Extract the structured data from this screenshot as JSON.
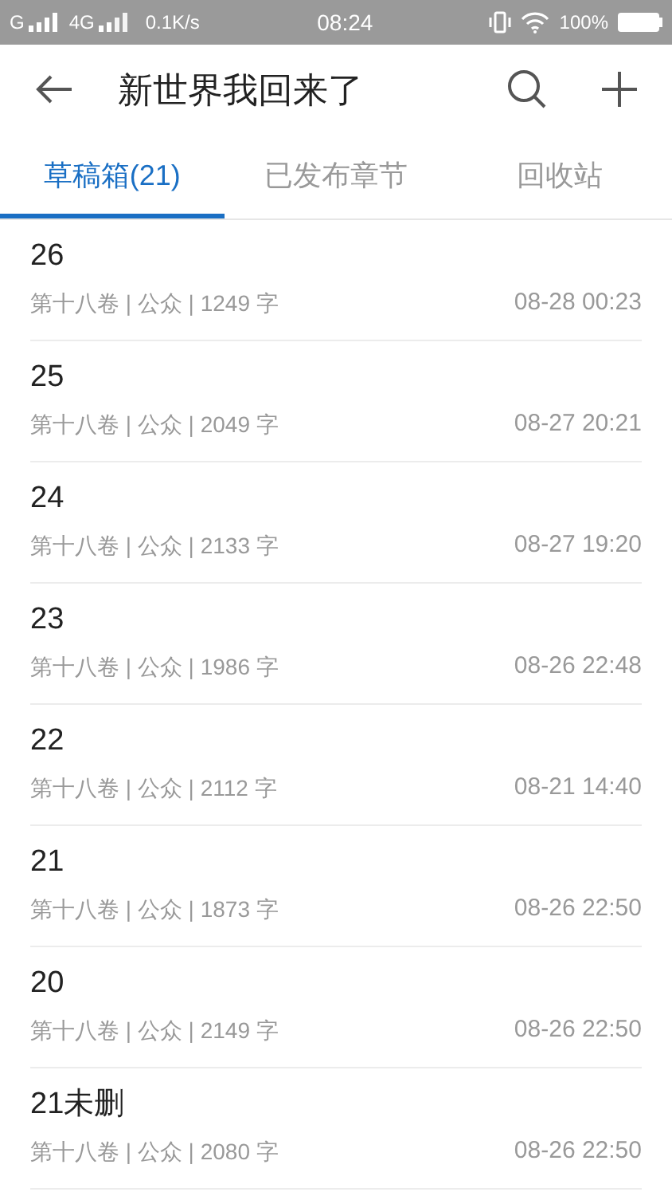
{
  "status_bar": {
    "carrier_1": "G",
    "carrier_2": "4G",
    "speed": "0.1K/s",
    "time": "08:24",
    "battery": "100%"
  },
  "header": {
    "title": "新世界我回来了"
  },
  "tabs": [
    {
      "label": "草稿箱(21)",
      "selected": true
    },
    {
      "label": "已发布章节",
      "selected": false
    },
    {
      "label": "回收站",
      "selected": false
    }
  ],
  "chapters": [
    {
      "title": "26",
      "meta": "第十八卷 | 公众 | 1249 字",
      "time": "08-28 00:23"
    },
    {
      "title": "25",
      "meta": "第十八卷 | 公众 | 2049 字",
      "time": "08-27 20:21"
    },
    {
      "title": "24",
      "meta": "第十八卷 | 公众 | 2133 字",
      "time": "08-27 19:20"
    },
    {
      "title": "23",
      "meta": "第十八卷 | 公众 | 1986 字",
      "time": "08-26 22:48"
    },
    {
      "title": "22",
      "meta": "第十八卷 | 公众 | 2112 字",
      "time": "08-21 14:40"
    },
    {
      "title": "21",
      "meta": "第十八卷 | 公众 | 1873 字",
      "time": "08-26 22:50"
    },
    {
      "title": "20",
      "meta": "第十八卷 | 公众 | 2149 字",
      "time": "08-26 22:50"
    },
    {
      "title": "21未删",
      "meta": "第十八卷 | 公众 | 2080 字",
      "time": "08-26 22:50"
    }
  ]
}
